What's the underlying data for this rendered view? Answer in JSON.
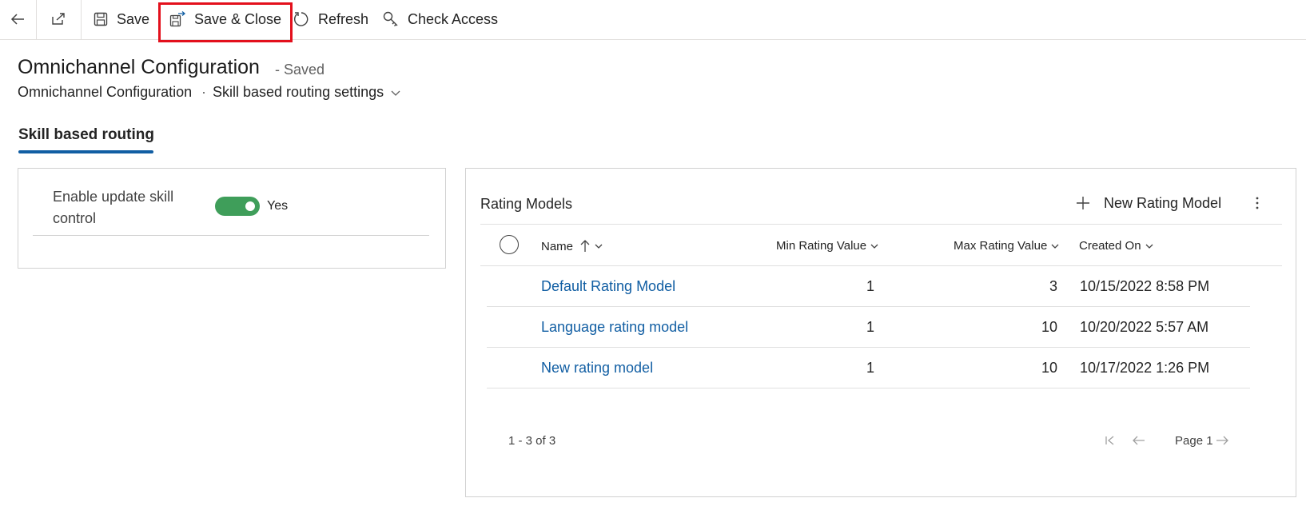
{
  "toolbar": {
    "save_label": "Save",
    "save_close_label": "Save & Close",
    "refresh_label": "Refresh",
    "check_access_label": "Check Access"
  },
  "header": {
    "title": "Omnichannel Configuration",
    "status": "- Saved",
    "breadcrumb": [
      "Omnichannel Configuration",
      "Skill based routing settings"
    ],
    "breadcrumb_separator": "·"
  },
  "tabs": [
    {
      "label": "Skill based routing",
      "selected": true
    }
  ],
  "settings": {
    "field_label": "Enable update skill control",
    "toggle_on": true,
    "toggle_value": "Yes"
  },
  "grid": {
    "title": "Rating Models",
    "new_label": "New Rating Model",
    "columns": [
      {
        "label": "Name",
        "sort": "ascending"
      },
      {
        "label": "Min Rating Value"
      },
      {
        "label": "Max Rating Value"
      },
      {
        "label": "Created On"
      }
    ],
    "rows": [
      {
        "name": "Default Rating Model",
        "min": "1",
        "max": "3",
        "created": "10/15/2022 8:58 PM"
      },
      {
        "name": "Language rating model",
        "min": "1",
        "max": "10",
        "created": "10/20/2022 5:57 AM"
      },
      {
        "name": "New rating model",
        "min": "1",
        "max": "10",
        "created": "10/17/2022 1:26 PM"
      }
    ],
    "count": "1 - 3 of 3",
    "page_label": "Page 1"
  },
  "colors": {
    "accent": "#115ea3",
    "toggle_on": "#3f9e5a",
    "highlight": "#e3101c"
  },
  "icons": [
    "back-arrow-icon",
    "open-new-window-icon",
    "save-icon",
    "save-close-icon",
    "refresh-icon",
    "check-access-icon",
    "chevron-down-icon",
    "plus-icon",
    "more-vertical-icon",
    "sort-up-arrow-icon",
    "first-page-icon",
    "previous-page-icon",
    "next-page-icon"
  ]
}
